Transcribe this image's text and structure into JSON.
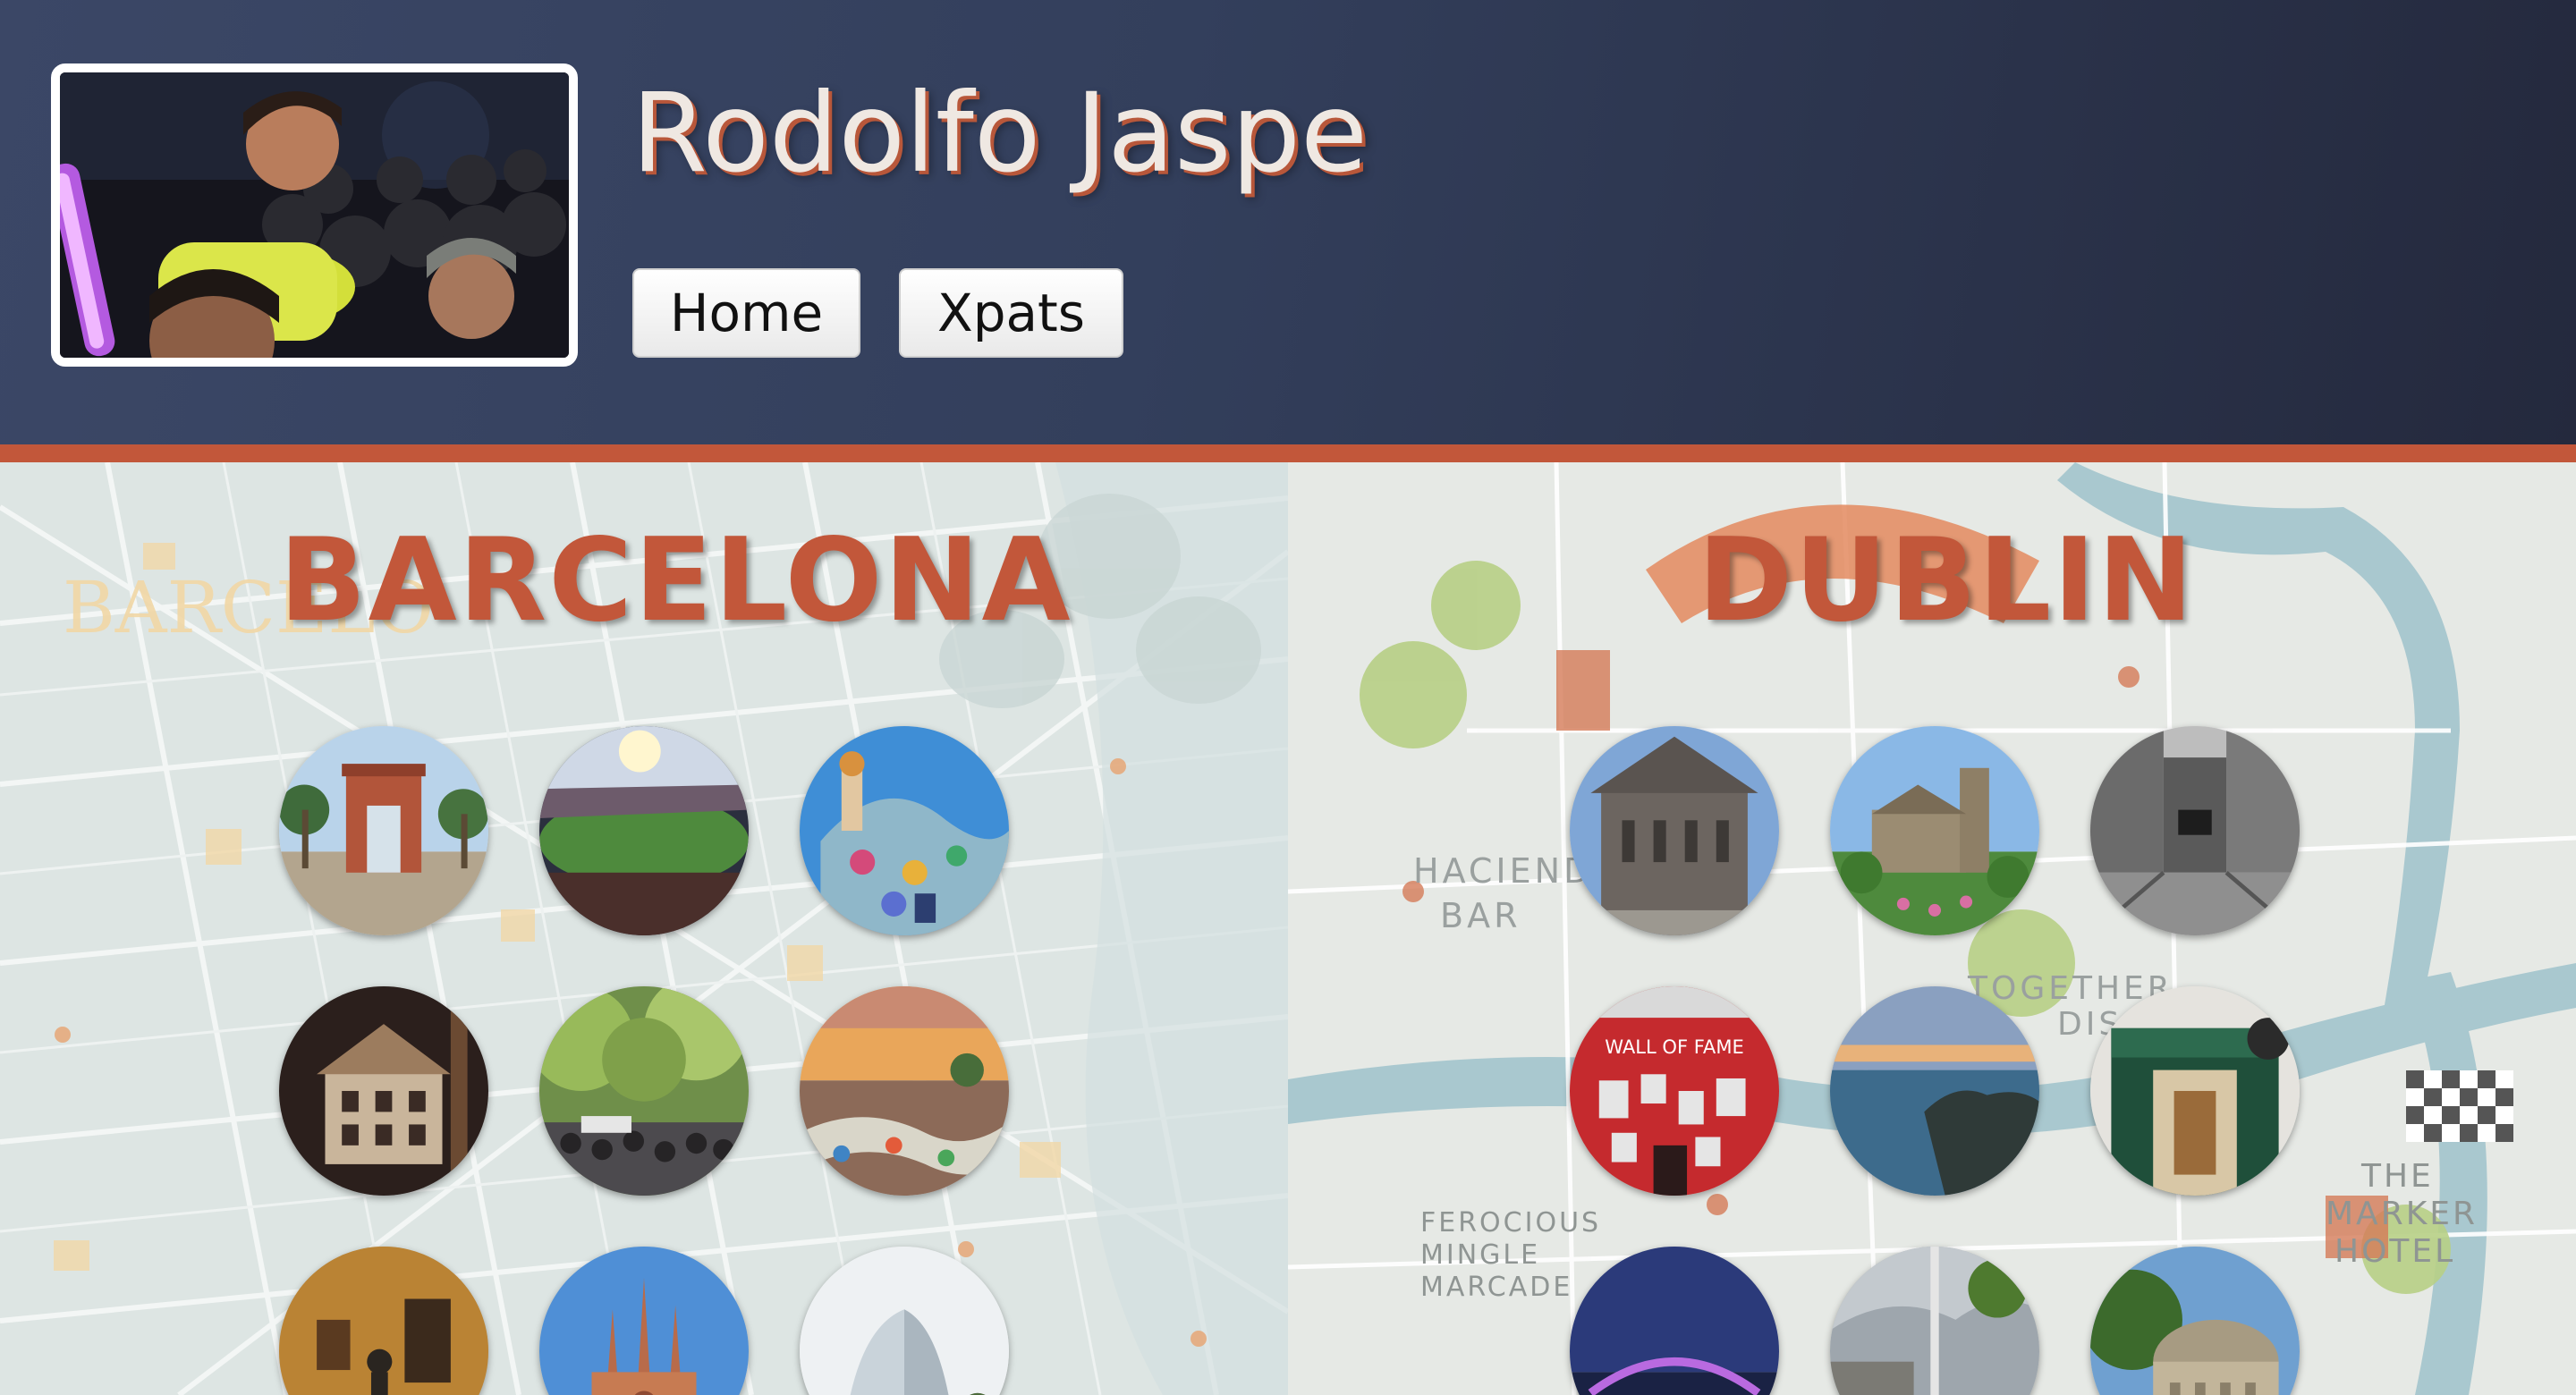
{
  "header": {
    "user_name": "Rodolfo Jaspe",
    "avatar_alt": "profile photo",
    "nav": [
      {
        "label": "Home"
      },
      {
        "label": "Xpats"
      }
    ]
  },
  "colors": {
    "header_bg": "#333f5c",
    "accent": "#c2573a",
    "title_text": "#efe8e2"
  },
  "cities": [
    {
      "name": "BARCELONA",
      "photos": [
        {
          "icon": "arc-de-triomf-photo"
        },
        {
          "icon": "stadium-photo"
        },
        {
          "icon": "casa-batllo-photo"
        },
        {
          "icon": "model-building-photo"
        },
        {
          "icon": "tree-lined-street-photo"
        },
        {
          "icon": "park-guell-photo"
        },
        {
          "icon": "museum-photo"
        },
        {
          "icon": "sagrada-familia-photo"
        },
        {
          "icon": "hotel-w-photo"
        }
      ]
    },
    {
      "name": "DUBLIN",
      "photos": [
        {
          "icon": "cathedral-photo"
        },
        {
          "icon": "church-garden-photo"
        },
        {
          "icon": "stone-street-photo"
        },
        {
          "icon": "wall-of-fame-photo"
        },
        {
          "icon": "sea-cliffs-photo"
        },
        {
          "icon": "distillery-photo"
        },
        {
          "icon": "bridge-night-photo"
        },
        {
          "icon": "spire-photo"
        },
        {
          "icon": "dome-building-photo"
        }
      ]
    }
  ]
}
